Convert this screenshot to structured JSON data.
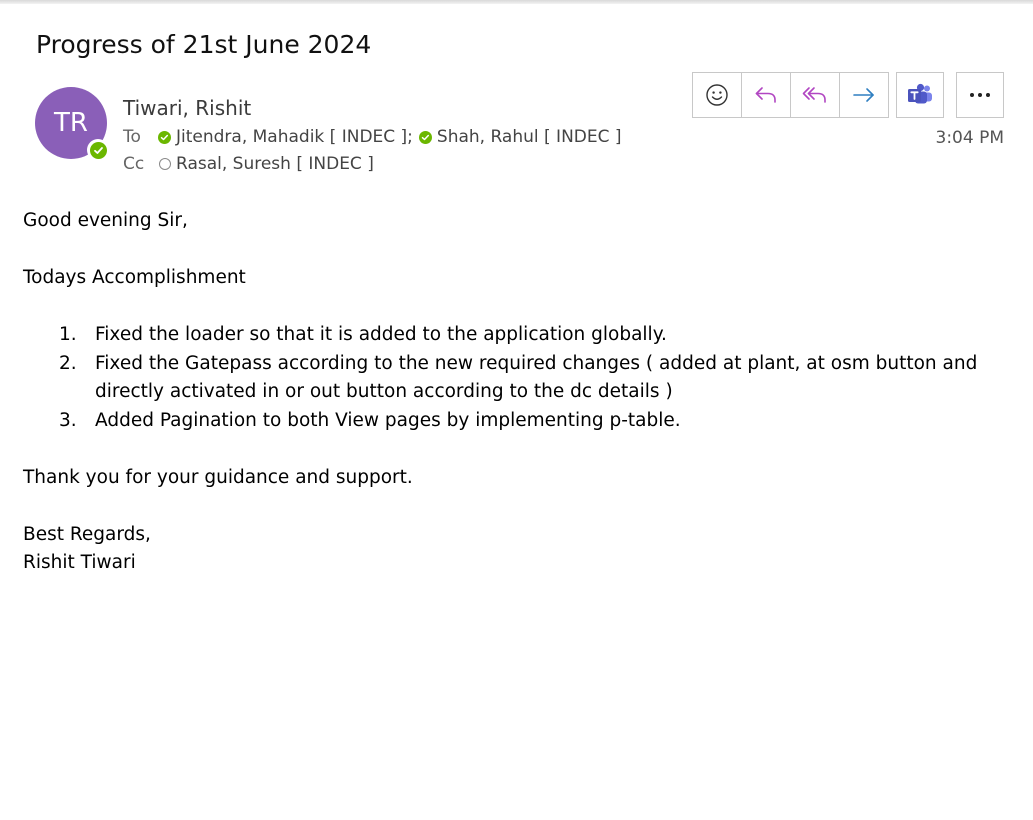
{
  "email": {
    "subject": "Progress of 21st June 2024",
    "avatar_initials": "TR",
    "sender": "Tiwari, Rishit",
    "to_label": "To",
    "cc_label": "Cc",
    "to": [
      {
        "name": "Jitendra, Mahadik [ INDEC ];",
        "status": "online"
      },
      {
        "name": "Shah, Rahul [ INDEC ]",
        "status": "online"
      }
    ],
    "cc": [
      {
        "name": "Rasal, Suresh [ INDEC ]",
        "status": "offline"
      }
    ],
    "time": "3:04 PM"
  },
  "toolbar": {
    "icons": [
      "emoji-icon",
      "reply-icon",
      "reply-all-icon",
      "forward-icon",
      "teams-icon",
      "more-icon"
    ]
  },
  "body": {
    "greeting": "Good evening Sir,",
    "heading": "Todays Accomplishment",
    "items": [
      {
        "num": "1.",
        "text": "Fixed the loader so that it is added to the application globally."
      },
      {
        "num": "2.",
        "text": "Fixed the Gatepass according to the new required changes ( added at plant,  at osm button and directly activated in or out button according to the dc details )"
      },
      {
        "num": "3.",
        "text": "Added Pagination to both View pages by implementing p-table."
      }
    ],
    "thanks": "Thank you for your guidance and support.",
    "signoff": "Best Regards,",
    "signature": "Rishit Tiwari"
  },
  "colors": {
    "avatar": "#8a5fb8",
    "presence": "#6bb700",
    "reply": "#b146c2",
    "forward": "#2f7fc1",
    "teams": "#5059c9"
  }
}
